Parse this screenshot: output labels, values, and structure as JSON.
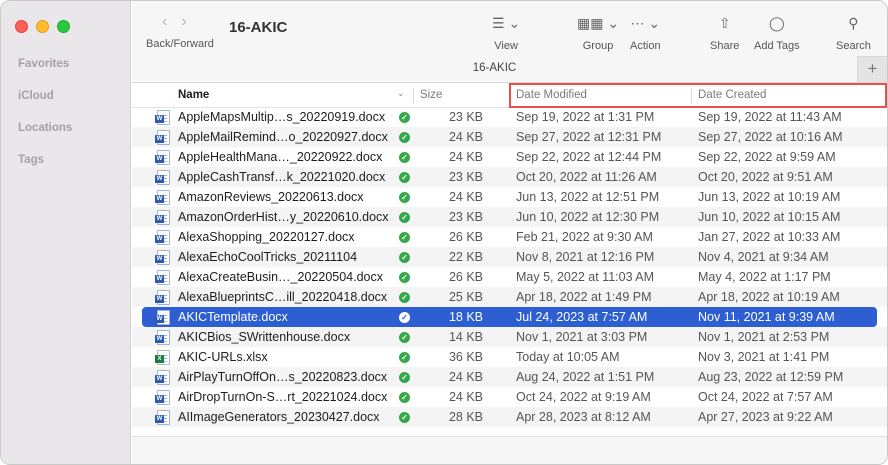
{
  "window": {
    "folder_title": "16-AKIC",
    "tab_title": "16-AKIC"
  },
  "sidebar": {
    "sections": [
      "Favorites",
      "iCloud",
      "Locations",
      "Tags"
    ]
  },
  "toolbar": {
    "back_forward_label": "Back/Forward",
    "view_label": "View",
    "group_label": "Group",
    "action_label": "Action",
    "share_label": "Share",
    "add_tags_label": "Add Tags",
    "search_label": "Search",
    "new_tab_symbol": "+"
  },
  "columns": {
    "name": "Name",
    "size": "Size",
    "date_modified": "Date Modified",
    "date_created": "Date Created"
  },
  "accent": {
    "selection": "#2d5fd3",
    "highlight_box": "#e8514a",
    "synced_check": "#35a84a"
  },
  "files": [
    {
      "name": "AppleMapsMultip…s_20220919.docx",
      "type": "word",
      "size": "23 KB",
      "modified": "Sep 19, 2022 at 1:31 PM",
      "created": "Sep 19, 2022 at 11:43 AM"
    },
    {
      "name": "AppleMailRemind…o_20220927.docx",
      "type": "word",
      "size": "24 KB",
      "modified": "Sep 27, 2022 at 12:31 PM",
      "created": "Sep 27, 2022 at 10:16 AM"
    },
    {
      "name": "AppleHealthMana…_20220922.docx",
      "type": "word",
      "size": "24 KB",
      "modified": "Sep 22, 2022 at 12:44 PM",
      "created": "Sep 22, 2022 at 9:59 AM"
    },
    {
      "name": "AppleCashTransf…k_20221020.docx",
      "type": "word",
      "size": "23 KB",
      "modified": "Oct 20, 2022 at 11:26 AM",
      "created": "Oct 20, 2022 at 9:51 AM"
    },
    {
      "name": "AmazonReviews_20220613.docx",
      "type": "word",
      "size": "24 KB",
      "modified": "Jun 13, 2022 at 12:51 PM",
      "created": "Jun 13, 2022 at 10:19 AM"
    },
    {
      "name": "AmazonOrderHist…y_20220610.docx",
      "type": "word",
      "size": "23 KB",
      "modified": "Jun 10, 2022 at 12:30 PM",
      "created": "Jun 10, 2022 at 10:15 AM"
    },
    {
      "name": "AlexaShopping_20220127.docx",
      "type": "word",
      "size": "26 KB",
      "modified": "Feb 21, 2022 at 9:30 AM",
      "created": "Jan 27, 2022 at 10:33 AM"
    },
    {
      "name": "AlexaEchoCoolTricks_20211104",
      "type": "word",
      "size": "22 KB",
      "modified": "Nov 8, 2021 at 12:16 PM",
      "created": "Nov 4, 2021 at 9:34 AM"
    },
    {
      "name": "AlexaCreateBusin…_20220504.docx",
      "type": "word",
      "size": "26 KB",
      "modified": "May 5, 2022 at 11:03 AM",
      "created": "May 4, 2022 at 1:17 PM"
    },
    {
      "name": "AlexaBlueprintsC…ill_20220418.docx",
      "type": "word",
      "size": "25 KB",
      "modified": "Apr 18, 2022 at 1:49 PM",
      "created": "Apr 18, 2022 at 10:19 AM"
    },
    {
      "name": "AKICTemplate.docx",
      "type": "word",
      "size": "18 KB",
      "modified": "Jul 24, 2023 at 7:57 AM",
      "created": "Nov 11, 2021 at 9:39 AM",
      "selected": true
    },
    {
      "name": "AKICBios_SWrittenhouse.docx",
      "type": "word",
      "size": "14 KB",
      "modified": "Nov 1, 2021 at 3:03 PM",
      "created": "Nov 1, 2021 at 2:53 PM"
    },
    {
      "name": "AKIC-URLs.xlsx",
      "type": "excel",
      "size": "36 KB",
      "modified": "Today at 10:05 AM",
      "created": "Nov 3, 2021 at 1:41 PM"
    },
    {
      "name": "AirPlayTurnOffOn…s_20220823.docx",
      "type": "word",
      "size": "24 KB",
      "modified": "Aug 24, 2022 at 1:51 PM",
      "created": "Aug 23, 2022 at 12:59 PM"
    },
    {
      "name": "AirDropTurnOn-S…rt_20221024.docx",
      "type": "word",
      "size": "24 KB",
      "modified": "Oct 24, 2022 at 9:19 AM",
      "created": "Oct 24, 2022 at 7:57 AM"
    },
    {
      "name": "AIImageGenerators_20230427.docx",
      "type": "word",
      "size": "28 KB",
      "modified": "Apr 28, 2023 at 8:12 AM",
      "created": "Apr 27, 2023 at 9:22 AM"
    }
  ]
}
